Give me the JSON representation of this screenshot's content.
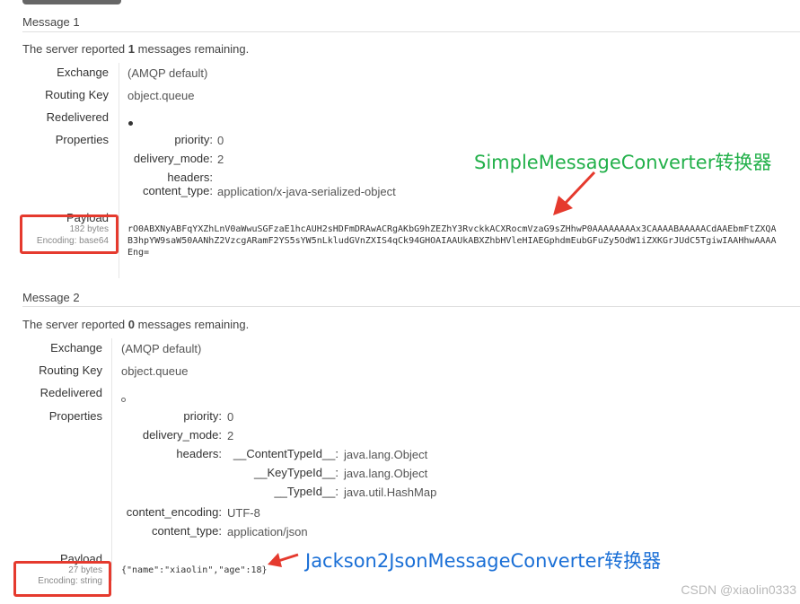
{
  "messages": [
    {
      "header": "Message 1",
      "summary_prefix": "The server reported",
      "remaining": "1",
      "summary_suffix": "messages remaining.",
      "labels": {
        "exchange": "Exchange",
        "routing_key": "Routing Key",
        "redelivered": "Redelivered",
        "properties": "Properties",
        "payload": "Payload"
      },
      "exchange": "(AMQP default)",
      "routing_key": "object.queue",
      "redelivered": true,
      "properties": [
        {
          "key": "priority:",
          "value": "0"
        },
        {
          "key": "delivery_mode:",
          "value": "2"
        },
        {
          "key": "headers:",
          "value": ""
        },
        {
          "key": "content_type:",
          "value": "application/x-java-serialized-object"
        }
      ],
      "payload_size": "182 bytes",
      "payload_encoding": "Encoding: base64",
      "payload": "rO0ABXNyABFqYXZhLnV0aWwuSGFzaE1hcAUH2sHDFmDRAwACRgAKbG9hZEZhY3RvckkACXRocmVzaG9sZHhwP0AAAAAAAAx3CAAAABAAAAACdAAEbmFtZXQAB3hpYW9saW50AANhZ2VzcgARamF2YS5sYW5nLkludGVnZXIS4qCk94GHOAIAAUkABXZhbHVleHIAEGphdmEubGFuZy5OdW1iZXKGrJUdC5TgiwIAAHhwAAAAEng="
    },
    {
      "header": "Message 2",
      "summary_prefix": "The server reported",
      "remaining": "0",
      "summary_suffix": "messages remaining.",
      "labels": {
        "exchange": "Exchange",
        "routing_key": "Routing Key",
        "redelivered": "Redelivered",
        "properties": "Properties",
        "payload": "Payload"
      },
      "exchange": "(AMQP default)",
      "routing_key": "object.queue",
      "redelivered": false,
      "properties": [
        {
          "key": "priority:",
          "value": "0"
        },
        {
          "key": "delivery_mode:",
          "value": "2"
        },
        {
          "key": "headers:",
          "value": ""
        },
        {
          "key": "content_encoding:",
          "value": "UTF-8"
        },
        {
          "key": "content_type:",
          "value": "application/json"
        }
      ],
      "headers": [
        {
          "key": "__ContentTypeId__:",
          "value": "java.lang.Object"
        },
        {
          "key": "__KeyTypeId__:",
          "value": "java.lang.Object"
        },
        {
          "key": "__TypeId__:",
          "value": "java.util.HashMap"
        }
      ],
      "payload_size": "27 bytes",
      "payload_encoding": "Encoding: string",
      "payload": "{\"name\":\"xiaolin\",\"age\":18}"
    }
  ],
  "annotations": {
    "converter1": "SimpleMessageConverter转换器",
    "converter2": "Jackson2JsonMessageConverter转换器"
  },
  "watermark": "CSDN @xiaolin0333",
  "colors": {
    "annotation_green": "#22b04a",
    "annotation_blue": "#1a6fd6",
    "highlight_red": "#e53a2e"
  }
}
